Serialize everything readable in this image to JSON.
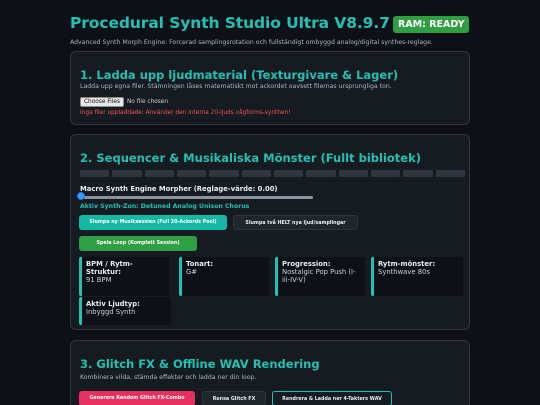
{
  "header": {
    "title": "Procedural Synth Studio Ultra V8.9.7",
    "subtitle": "Advanced Synth Morph Engine: Forcerad samplingsrotation och fullständigt ombyggd analog/digital synthes-reglage.",
    "ram_badge": "RAM: READY"
  },
  "upload": {
    "title": "1. Ladda upp ljudmaterial (Texturgivare & Lager)",
    "description": "Ladda upp egna filer. Stämningen låses matematiskt mot ackordet oavsett filernas ursprungliga ton.",
    "file_button": "Choose Files",
    "file_status": "No file chosen",
    "warning": "Inga filer uppladdade: Använder den interna 20-ljuds vågforms-synthen!"
  },
  "sequencer": {
    "title": "2. Sequencer & Musikaliska Mönster (Fullt bibliotek)",
    "step_count": 12,
    "macro_label": "Macro Synth Engine Morpher (Reglage-värde: 0.00)",
    "macro_value": 0.0,
    "zone_label": "Aktiv Synth-Zon: Detuned Analog Unison Chorus",
    "buttons": {
      "random_session": "Slumpa ny Musiksession (Full 20-Ackords Pool)",
      "random_sounds": "Slumpa två HELT nya ljud/samplingar",
      "play_loop": "Spela Loop (Komplett Session)"
    },
    "stats": [
      {
        "label": "BPM / Rytm-Struktur:",
        "value": "91 BPM"
      },
      {
        "label": "Tonart:",
        "value": "G#"
      },
      {
        "label": "Progression:",
        "value": "Nostalgic Pop Push (I-iii-IV-V)"
      },
      {
        "label": "Rytm-mönster:",
        "value": "Synthwave 80s"
      },
      {
        "label": "Aktiv Ljudtyp:",
        "value": "Inbyggd Synth"
      }
    ]
  },
  "render": {
    "title": "3. Glitch FX & Offline WAV Rendering",
    "description": "Kombinera vilda, stämda effekter och ladda ner din loop.",
    "buttons": {
      "random_glitch": "Generera Random Glitch FX-Combo",
      "clear_glitch": "Rensa Glitch FX",
      "render_download": "Rendrera & Ladda ner 4-Takters WAV"
    }
  },
  "colors": {
    "accent": "#22c1b3",
    "background": "#0d1117",
    "card": "#161b22",
    "warning": "#f85149",
    "success": "#2ea043",
    "danger_button": "#e7305e"
  }
}
